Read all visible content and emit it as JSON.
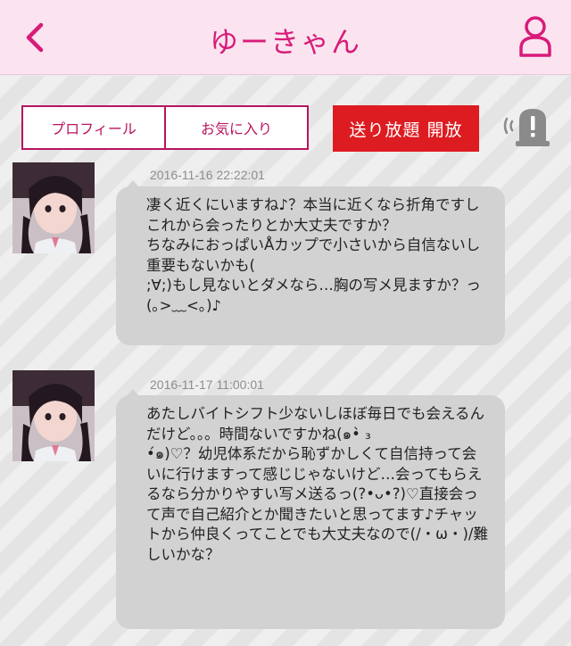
{
  "header": {
    "back_icon": "chevron-left-icon",
    "title": "ゆーきゃん",
    "profile_icon": "user-icon",
    "accent": "#d81b7a"
  },
  "toolbar": {
    "profile_tab": "プロフィール",
    "favorite_tab": "お気に入り",
    "unlimited_label": "送り放題 開放",
    "report_icon": "alert-siren-icon"
  },
  "messages": [
    {
      "timestamp": "2016-11-16 22:22:01",
      "text": "凄く近くにいますね♪？本当に近くなら折角ですしこれから会ったりとか大丈夫ですか？\nちなみにおっぱいÅカップで小さいから自信ないし重要もないかも(\n;∀;)もし見ないとダメなら…胸の写メ見ますか？っ(｡>﹏<｡)♪"
    },
    {
      "timestamp": "2016-11-17 11:00:01",
      "text": "あたしバイトシフト少ないしほぼ毎日でも会えるんだけど。。。時間ないですかね(๑•̀ ₃\n•́๑)♡？幼児体系だから恥ずかしくて自信持って会いに行けますって感じじゃないけど…会ってもらえるなら分かりやすい写メ送るっ(?•ᴗ•?)♡直接会って声で自己紹介とか聞きたいと思ってます♪チャットから仲良くってことでも大丈夫なので(/・ω・)/難しいかな？"
    }
  ],
  "colors": {
    "header_bg": "#fbe4ef",
    "tab_border": "#b8145f",
    "unlimited_bg": "#dd1c22",
    "bubble_bg": "#d2d2d2"
  }
}
